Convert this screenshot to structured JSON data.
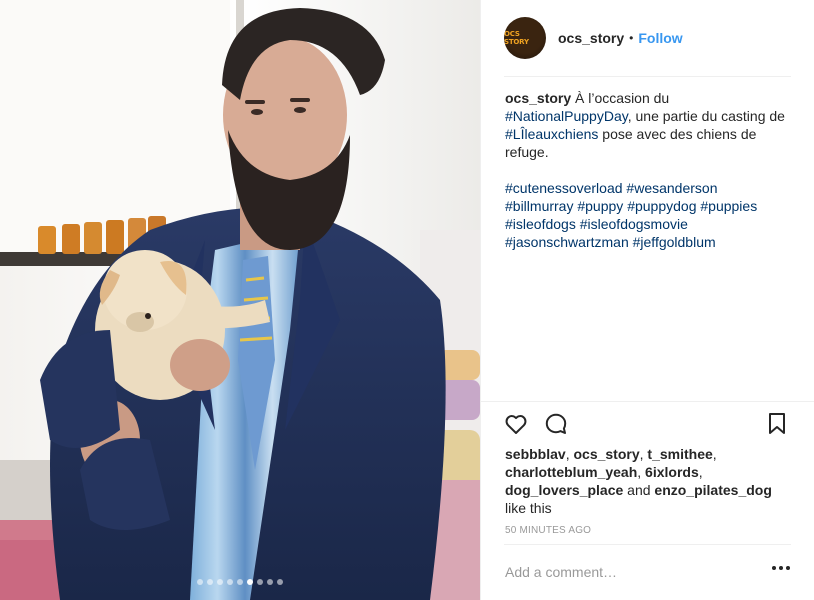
{
  "post": {
    "author": "ocs_story",
    "separator": "•",
    "follow_label": "Follow",
    "avatar_logo_text": "OCS STORY",
    "carousel": {
      "slide_count": 9,
      "active_index": 5
    }
  },
  "caption": {
    "username": "ocs_story",
    "text_1": " À l’occasion du ",
    "tag_1": "#NationalPuppyDay",
    "text_2": ", une partie du casting de ",
    "tag_2": "#LÎleauxchiens",
    "text_3": " pose avec des chiens de refuge.",
    "hashtags": [
      "#cutenessoverload",
      "#wesanderson",
      "#billmurray",
      "#puppy",
      "#puppydog",
      "#puppies",
      "#isleofdogs",
      "#isleofdogsmovie",
      "#jasonschwartzman",
      "#jeffgoldblum"
    ]
  },
  "actions": {
    "icons": [
      "heart-icon",
      "comment-icon",
      "bookmark-icon"
    ]
  },
  "likes": {
    "users": [
      "sebbblav",
      "ocs_story",
      "t_smithee",
      "charlotteblum_yeah",
      "6ixlords",
      "dog_lovers_place",
      "enzo_pilates_dog"
    ],
    "sep": ", ",
    "and": " and ",
    "suffix": " like this"
  },
  "timestamp": "50 MINUTES AGO",
  "comment": {
    "placeholder": "Add a comment…"
  },
  "colors": {
    "link": "#003569",
    "follow": "#3897f0",
    "muted": "#999999",
    "text": "#262626"
  }
}
